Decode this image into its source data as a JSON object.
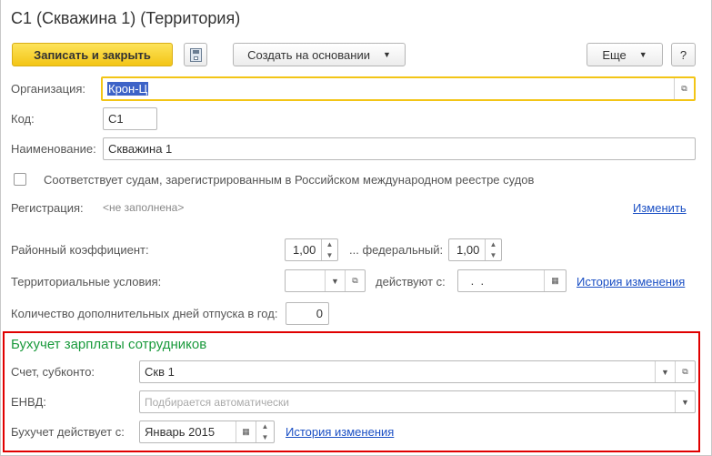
{
  "title": "С1 (Скважина 1) (Территория)",
  "toolbar": {
    "save_close": "Записать и закрыть",
    "create_based": "Создать на основании",
    "more": "Еще",
    "help": "?"
  },
  "form": {
    "org_label": "Организация:",
    "org_value": "Крон-Ц",
    "code_label": "Код:",
    "code_value": "С1",
    "name_label": "Наименование:",
    "name_value": "Скважина 1",
    "checkbox_label": "Соответствует судам, зарегистрированным в Российском международном реестре судов",
    "reg_label": "Регистрация:",
    "reg_value": "<не заполнена>",
    "reg_change": "Изменить",
    "coef_label": "Районный коэффициент:",
    "coef_value": "1,00",
    "fed_label": "... федеральный:",
    "fed_value": "1,00",
    "terr_label": "Территориальные условия:",
    "terr_value": "",
    "valid_label": "действуют с:",
    "valid_value": " .  .",
    "history": "История изменения",
    "days_label": "Количество дополнительных дней отпуска в год:",
    "days_value": "0"
  },
  "accounting": {
    "heading": "Бухучет зарплаты сотрудников",
    "account_label": "Счет, субконто:",
    "account_value": "Скв 1",
    "envd_label": "ЕНВД:",
    "envd_placeholder": "Подбирается автоматически",
    "from_label": "Бухучет действует с:",
    "from_value": "Январь 2015",
    "history": "История изменения"
  },
  "colors": {
    "accent": "#f3c516",
    "highlight": "#e00000",
    "heading": "#1a9a3c",
    "link": "#1a4fc4"
  }
}
